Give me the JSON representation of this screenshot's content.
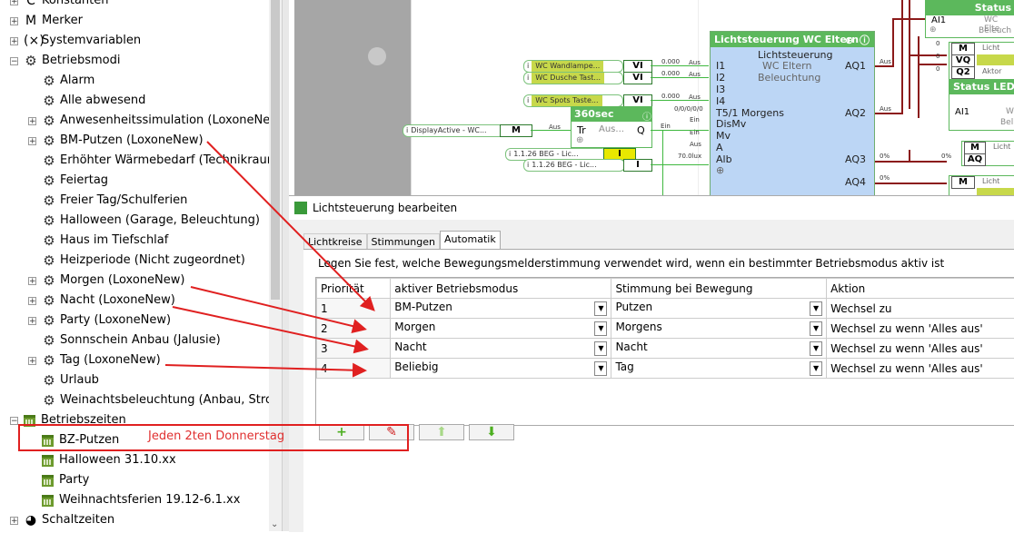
{
  "tree": {
    "items": [
      {
        "label": "Konstanten",
        "icon": "constant-icon",
        "glyph": "C",
        "exp": "+",
        "indent": 0
      },
      {
        "label": "Merker",
        "icon": "flag-icon",
        "glyph": "M",
        "exp": "+",
        "indent": 0
      },
      {
        "label": "Systemvariablen",
        "icon": "variable-icon",
        "glyph": "(×)",
        "exp": "+",
        "indent": 0
      },
      {
        "label": "Betriebsmodi",
        "icon": "gear-icon",
        "glyph": "⚙",
        "exp": "−",
        "indent": 0
      },
      {
        "label": "Alarm",
        "icon": "gear-icon",
        "glyph": "⚙",
        "exp": "",
        "indent": 1
      },
      {
        "label": "Alle abwesend",
        "icon": "gear-icon",
        "glyph": "⚙",
        "exp": "",
        "indent": 1
      },
      {
        "label": "Anwesenheitssimulation (LoxoneNew)",
        "icon": "gear-icon",
        "glyph": "⚙",
        "exp": "+",
        "indent": 1
      },
      {
        "label": "BM-Putzen (LoxoneNew)",
        "icon": "gear-icon",
        "glyph": "⚙",
        "exp": "+",
        "indent": 1
      },
      {
        "label": "Erhöhter Wärmebedarf (Technikraum,",
        "icon": "gear-icon",
        "glyph": "⚙",
        "exp": "",
        "indent": 1
      },
      {
        "label": "Feiertag",
        "icon": "gear-icon",
        "glyph": "⚙",
        "exp": "",
        "indent": 1
      },
      {
        "label": "Freier Tag/Schulferien",
        "icon": "gear-icon",
        "glyph": "⚙",
        "exp": "",
        "indent": 1
      },
      {
        "label": "Halloween (Garage, Beleuchtung)",
        "icon": "gear-icon",
        "glyph": "⚙",
        "exp": "",
        "indent": 1
      },
      {
        "label": "Haus im Tiefschlaf",
        "icon": "gear-icon",
        "glyph": "⚙",
        "exp": "",
        "indent": 1
      },
      {
        "label": "Heizperiode (Nicht zugeordnet)",
        "icon": "gear-icon",
        "glyph": "⚙",
        "exp": "",
        "indent": 1
      },
      {
        "label": "Morgen (LoxoneNew)",
        "icon": "gear-icon",
        "glyph": "⚙",
        "exp": "+",
        "indent": 1
      },
      {
        "label": "Nacht (LoxoneNew)",
        "icon": "gear-icon",
        "glyph": "⚙",
        "exp": "+",
        "indent": 1
      },
      {
        "label": "Party (LoxoneNew)",
        "icon": "gear-icon",
        "glyph": "⚙",
        "exp": "+",
        "indent": 1
      },
      {
        "label": "Sonnschein Anbau (Jalusie)",
        "icon": "gear-icon",
        "glyph": "⚙",
        "exp": "",
        "indent": 1
      },
      {
        "label": "Tag (LoxoneNew)",
        "icon": "gear-icon",
        "glyph": "⚙",
        "exp": "+",
        "indent": 1
      },
      {
        "label": "Urlaub",
        "icon": "gear-icon",
        "glyph": "⚙",
        "exp": "",
        "indent": 1
      },
      {
        "label": "Weinachtsbeleuchtung (Anbau, Strom",
        "icon": "gear-icon",
        "glyph": "⚙",
        "exp": "",
        "indent": 1
      },
      {
        "label": "Betriebszeiten",
        "icon": "calendar-icon",
        "glyph": "",
        "exp": "−",
        "indent": 0
      },
      {
        "label": "BZ-Putzen",
        "icon": "calendar-icon",
        "glyph": "",
        "exp": "",
        "indent": 1
      },
      {
        "label": "Halloween 31.10.xx",
        "icon": "calendar-icon",
        "glyph": "",
        "exp": "",
        "indent": 1
      },
      {
        "label": "Party",
        "icon": "calendar-icon",
        "glyph": "",
        "exp": "",
        "indent": 1
      },
      {
        "label": "Weihnachtsferien 19.12-6.1.xx",
        "icon": "calendar-icon",
        "glyph": "",
        "exp": "",
        "indent": 1
      },
      {
        "label": "Schaltzeiten",
        "icon": "clock-icon",
        "glyph": "◕",
        "exp": "+",
        "indent": 0
      }
    ]
  },
  "canvas": {
    "inputs": [
      {
        "label": "WC Wandlampe...",
        "value": "0.000",
        "out": "Aus",
        "v": "VI"
      },
      {
        "label": "WC Dusche Tast...",
        "value": "0.000",
        "out": "Aus",
        "v": "VI"
      },
      {
        "label": "WC Spots Taste...",
        "value": "0.000",
        "out": "Aus",
        "v": "VI"
      }
    ],
    "display_active": "DisplayActive - WC...",
    "display_m": "M",
    "beg1": "1.1.26 BEG - Lic...",
    "beg2": "1.1.26 BEG - Lic...",
    "beg2_val": "70.0lux",
    "beg_i": "I",
    "timer": {
      "title": "360sec",
      "tr": "Tr",
      "q": "Q",
      "aus": "Aus...",
      "ein1": "Ein",
      "ein2": "Ein",
      "aus2": "Aus"
    },
    "lichtsteuerung": {
      "title": "Lichtsteuerung WC Eltern",
      "sub": "Lichtsteuerung",
      "name1": "WC Eltern",
      "name2": "Beleuchtung",
      "inputs": [
        "I1",
        "I2",
        "I3",
        "I4",
        "T5/1 Morgens",
        "DisMv",
        "Mv",
        "A",
        "Alb"
      ],
      "outputs": [
        "AQ1",
        "AQ2",
        "AQ3",
        "AQ4"
      ],
      "t5val": "0/0/0/0/0"
    },
    "status1": {
      "title": "Status",
      "ai": "AI1",
      "line1": "WC Elte",
      "line2": "Beleuch"
    },
    "status2": {
      "title": "Status LED G",
      "ai": "AI1",
      "line1": "W",
      "line2": "Bel"
    },
    "small_labels": {
      "m": "M",
      "vq": "VQ",
      "q2": "Q2",
      "aq": "AQ",
      "licht": "Licht",
      "aktor": "Aktor",
      "zero": "0",
      "pct": "0%"
    }
  },
  "dialog": {
    "title": "Lichtsteuerung bearbeiten",
    "tabs": [
      "Lichtkreise",
      "Stimmungen",
      "Automatik"
    ],
    "active_tab": 2,
    "description": "Legen Sie fest, welche Bewegungsmelderstimmung verwendet wird, wenn ein bestimmter Betriebsmodus aktiv ist",
    "columns": [
      "Priorität",
      "aktiver Betriebsmodus",
      "Stimmung bei Bewegung",
      "Aktion"
    ],
    "rows": [
      {
        "prio": "1",
        "mode": "BM-Putzen",
        "mood": "Putzen",
        "action": "Wechsel zu"
      },
      {
        "prio": "2",
        "mode": "Morgen",
        "mood": "Morgens",
        "action": "Wechsel zu wenn 'Alles aus'"
      },
      {
        "prio": "3",
        "mode": "Nacht",
        "mood": "Nacht",
        "action": "Wechsel zu wenn 'Alles aus'"
      },
      {
        "prio": "4",
        "mode": "Beliebig",
        "mood": "Tag",
        "action": "Wechsel zu wenn 'Alles aus'"
      }
    ],
    "buttons": {
      "add": "+",
      "erase": "✎",
      "up": "⬆",
      "down": "⬇"
    }
  },
  "annotation": {
    "note": "Jeden 2ten Donnerstag",
    "color": "#e02020"
  }
}
